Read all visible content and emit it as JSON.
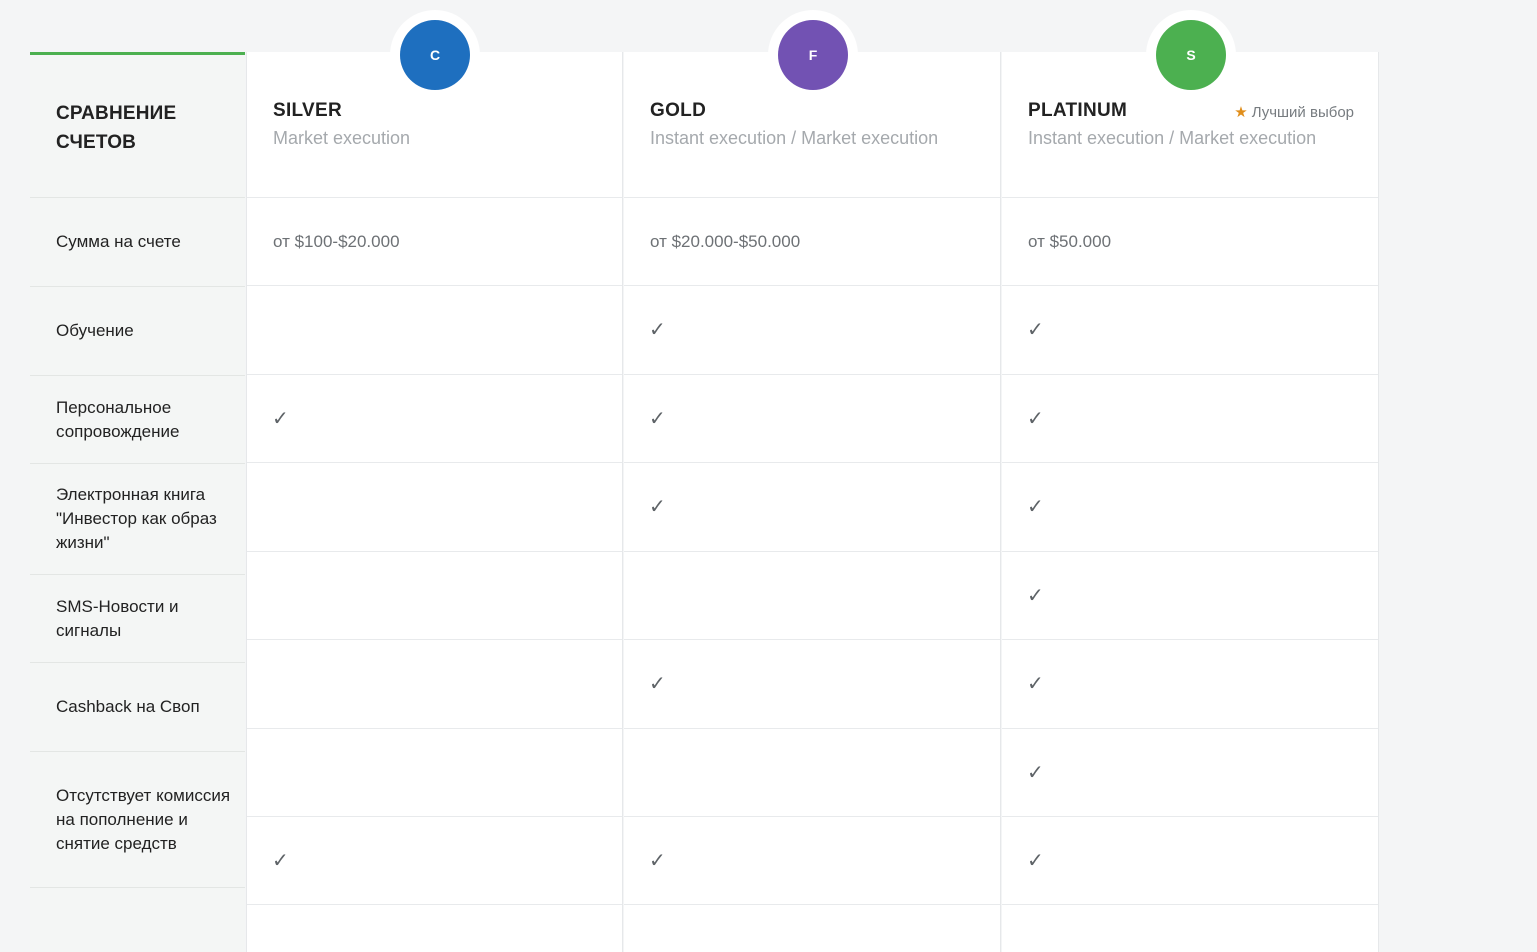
{
  "header": {
    "title": "СРАВНЕНИЕ СЧЕТОВ"
  },
  "plans": [
    {
      "badge": "C",
      "color": "#1e6fbf",
      "name": "SILVER",
      "execution": "Market execution",
      "best_label": ""
    },
    {
      "badge": "F",
      "color": "#7252b3",
      "name": "GOLD",
      "execution": "Instant execution / Market execution",
      "best_label": ""
    },
    {
      "badge": "S",
      "color": "#4cb050",
      "name": "PLATINUM",
      "execution": "Instant execution / Market execution",
      "best_label": "Лучший выбор"
    }
  ],
  "rows": [
    {
      "label": "Сумма на счете",
      "values": [
        "от $100-$20.000",
        "от $20.000-$50.000",
        "от $50.000"
      ]
    },
    {
      "label": "Обучение",
      "values": [
        "",
        "✓",
        "✓"
      ]
    },
    {
      "label": "Персональное сопровождение",
      "values": [
        "✓",
        "✓",
        "✓"
      ]
    },
    {
      "label": "Электронная книга \"Инвестор как образ жизни\"",
      "values": [
        "",
        "✓",
        "✓"
      ]
    },
    {
      "label": "SMS-Новости и сигналы",
      "values": [
        "",
        "",
        "✓"
      ]
    },
    {
      "label": "Cashback на Своп",
      "values": [
        "",
        "✓",
        "✓"
      ]
    },
    {
      "label": "Отсутствует комиссия на пополнение и снятие средств",
      "values": [
        "",
        "",
        "✓"
      ]
    },
    {
      "label": "",
      "values": [
        "✓",
        "✓",
        "✓"
      ]
    }
  ],
  "icons": {
    "check": "checkmark-icon",
    "star": "star-icon"
  },
  "colors": {
    "accent": "#4cb050",
    "star": "#e08e1b"
  }
}
